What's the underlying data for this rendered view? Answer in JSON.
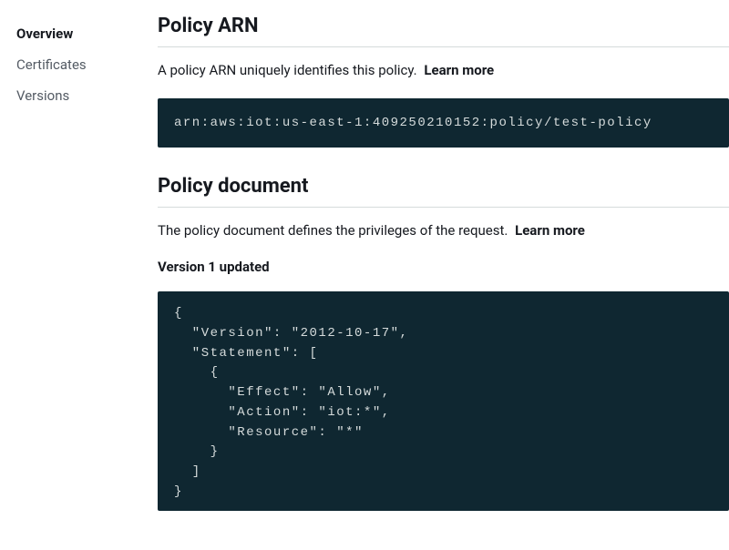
{
  "sidebar": {
    "items": [
      {
        "label": "Overview"
      },
      {
        "label": "Certificates"
      },
      {
        "label": "Versions"
      }
    ]
  },
  "arn_section": {
    "title": "Policy ARN",
    "description": "A policy ARN uniquely identifies this policy.",
    "learn_more": "Learn more",
    "arn_value": "arn:aws:iot:us-east-1:409250210152:policy/test-policy"
  },
  "doc_section": {
    "title": "Policy document",
    "description": "The policy document defines the privileges of the request.",
    "learn_more": "Learn more",
    "version_label": "Version 1 updated",
    "policy_json": "{\n  \"Version\": \"2012-10-17\",\n  \"Statement\": [\n    {\n      \"Effect\": \"Allow\",\n      \"Action\": \"iot:*\",\n      \"Resource\": \"*\"\n    }\n  ]\n}"
  }
}
